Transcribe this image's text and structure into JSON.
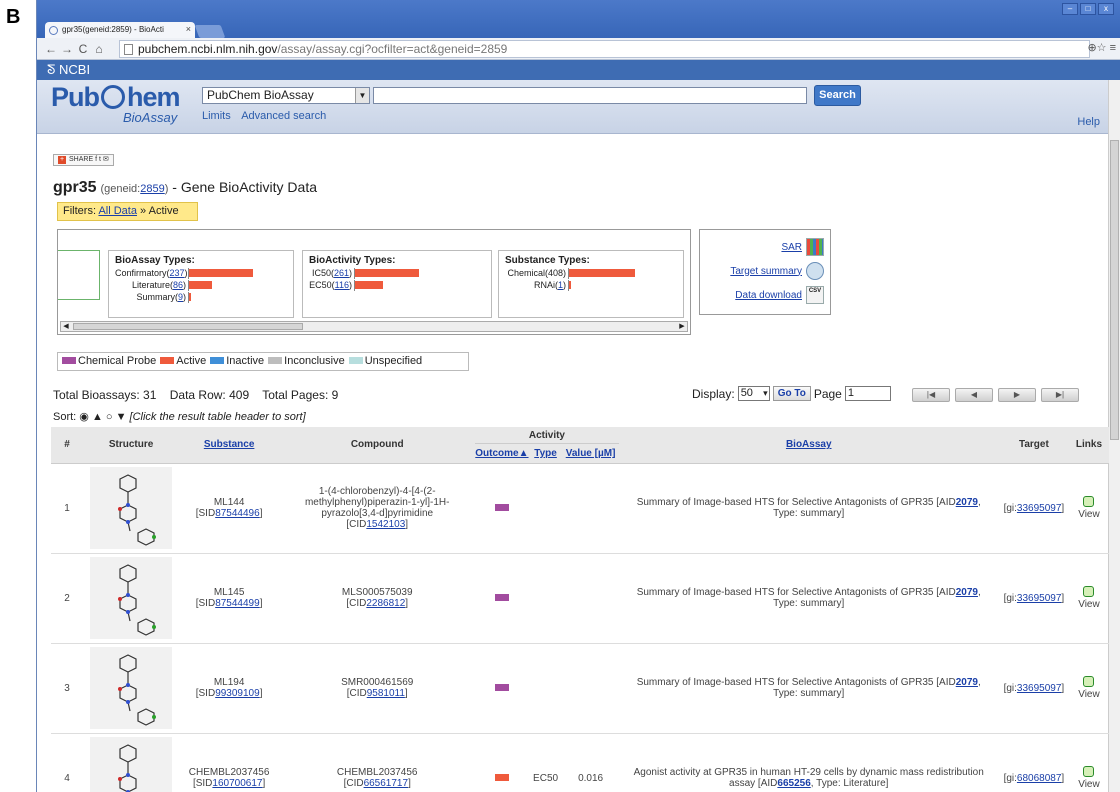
{
  "figure_label": "B",
  "browser": {
    "tab_title": "gpr35(geneid:2859) - BioActi",
    "tab_close": "×",
    "url_host": "pubchem.ncbi.nlm.nih.gov",
    "url_path": "/assay/assay.cgi?ocfilter=act&geneid=2859",
    "window_buttons": [
      "–",
      "□",
      "x"
    ],
    "toolbar_right": "⊕☆ ≡"
  },
  "ncbi": {
    "label": "NCBI"
  },
  "header": {
    "logo_pub": "Pub",
    "logo_hem": "hem",
    "logo_sub": "BioAssay",
    "db_select": "PubChem BioAssay",
    "search_value": "",
    "search_button": "Search",
    "limits": "Limits",
    "advanced": "Advanced search",
    "help": "Help"
  },
  "share": {
    "label": "SHARE",
    "icons": "f t ✉"
  },
  "title": {
    "gene": "gpr35",
    "geneid_prefix": "(geneid:",
    "geneid": "2859",
    "geneid_suffix": ")",
    "rest": " - Gene BioActivity Data"
  },
  "filters": {
    "label": "Filters:",
    "all": "All Data",
    "sep": " » ",
    "active": "Active"
  },
  "summary": {
    "bioassay_types": {
      "title": "BioAssay Types:",
      "items": [
        {
          "label": "Confirmatory",
          "count": "237",
          "value": 237
        },
        {
          "label": "Literature",
          "count": "86",
          "value": 86
        },
        {
          "label": "Summary",
          "count": "9",
          "value": 9
        }
      ]
    },
    "bioactivity_types": {
      "title": "BioActivity Types:",
      "items": [
        {
          "label": "IC50",
          "count": "261",
          "value": 261
        },
        {
          "label": "EC50",
          "count": "116",
          "value": 116
        }
      ]
    },
    "substance_types": {
      "title": "Substance Types:",
      "items": [
        {
          "label": "Chemical(408)",
          "count": "",
          "value": 408
        },
        {
          "label": "RNAi",
          "count": "1",
          "value": 1
        }
      ]
    }
  },
  "links_box": {
    "sar": "SAR",
    "target_summary": "Target summary",
    "data_download": "Data download",
    "csv": "CSV"
  },
  "legend": [
    {
      "label": "Chemical Probe",
      "color": "#a24c9f"
    },
    {
      "label": "Active",
      "color": "#ef5a3c"
    },
    {
      "label": "Inactive",
      "color": "#3f8fd8"
    },
    {
      "label": "Inconclusive",
      "color": "#bdbdbd"
    },
    {
      "label": "Unspecified",
      "color": "#b7dede"
    }
  ],
  "totals": {
    "bioassays": "Total Bioassays: 31",
    "rows": "Data Row: 409",
    "pages": "Total Pages: 9"
  },
  "display": {
    "label": "Display:",
    "value": "50",
    "goto": "Go To",
    "page_label": "Page",
    "page_value": "1"
  },
  "pager": [
    "|◀",
    "◀",
    "▶",
    "▶|"
  ],
  "sort": {
    "label": "Sort:",
    "symbols": "◉ ▲ ○ ▼",
    "hint": "[Click the result table header to sort]"
  },
  "table": {
    "headers": {
      "num": "#",
      "structure": "Structure",
      "substance": "Substance",
      "compound": "Compound",
      "activity": "Activity",
      "outcome": "Outcome▲",
      "type": "Type",
      "value": "Value [µM]",
      "bioassay": "BioAssay",
      "target": "Target",
      "links": "Links"
    },
    "rows": [
      {
        "num": "1",
        "sub_name": "ML144",
        "sid_pre": "[SID",
        "sid": "87544496",
        "sid_post": "]",
        "cmp_name": "1-(4-chlorobenzyl)-4-[4-(2-methylphenyl)piperazin-1-yl]-1H-pyrazolo[3,4-d]pyrimidine",
        "cid_pre": "[CID",
        "cid": "1542103",
        "cid_post": "]",
        "outcome_color": "#a24c9f",
        "type": "",
        "value": "",
        "bioassay_text": "Summary of Image-based HTS for Selective Antagonists of GPR35 [AID",
        "aid": "2079",
        "bioassay_suffix": ", Type: summary]",
        "target_pre": "[gi:",
        "gi": "33695097",
        "target_post": "]",
        "view": "View"
      },
      {
        "num": "2",
        "sub_name": "ML145",
        "sid_pre": "[SID",
        "sid": "87544499",
        "sid_post": "]",
        "cmp_name": "MLS000575039",
        "cid_pre": "[CID",
        "cid": "2286812",
        "cid_post": "]",
        "outcome_color": "#a24c9f",
        "type": "",
        "value": "",
        "bioassay_text": "Summary of Image-based HTS for Selective Antagonists of GPR35 [AID",
        "aid": "2079",
        "bioassay_suffix": ", Type: summary]",
        "target_pre": "[gi:",
        "gi": "33695097",
        "target_post": "]",
        "view": "View"
      },
      {
        "num": "3",
        "sub_name": "ML194",
        "sid_pre": "[SID",
        "sid": "99309109",
        "sid_post": "]",
        "cmp_name": "SMR000461569",
        "cid_pre": "[CID",
        "cid": "9581011",
        "cid_post": "]",
        "outcome_color": "#a24c9f",
        "type": "",
        "value": "",
        "bioassay_text": "Summary of Image-based HTS for Selective Antagonists of GPR35 [AID",
        "aid": "2079",
        "bioassay_suffix": ", Type: summary]",
        "target_pre": "[gi:",
        "gi": "33695097",
        "target_post": "]",
        "view": "View"
      },
      {
        "num": "4",
        "sub_name": "CHEMBL2037456",
        "sid_pre": "[SID",
        "sid": "160700617",
        "sid_post": "]",
        "cmp_name": "CHEMBL2037456",
        "cid_pre": "[CID",
        "cid": "66561717",
        "cid_post": "]",
        "outcome_color": "#ef5a3c",
        "type": "EC50",
        "value": "0.016",
        "bioassay_text": "Agonist activity at GPR35 in human HT-29 cells by dynamic mass redistribution assay [AID",
        "aid": "665256",
        "bioassay_suffix": ", Type: Literature]",
        "target_pre": "[gi:",
        "gi": "68068087",
        "target_post": "]",
        "view": "View"
      }
    ]
  }
}
